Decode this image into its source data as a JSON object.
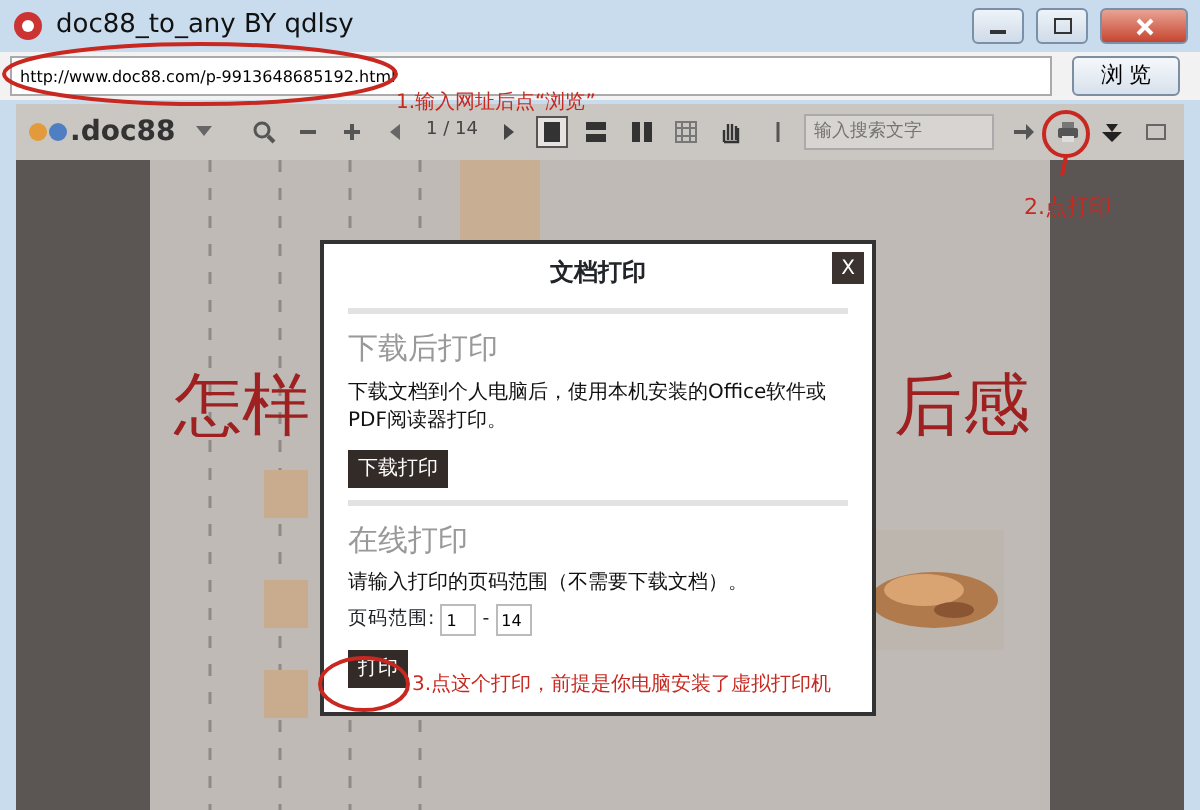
{
  "window": {
    "title": "doc88_to_any BY qdlsy"
  },
  "address_bar": {
    "value": "http://www.doc88.com/p-9913648685192.html",
    "button": "浏 览"
  },
  "toolbar": {
    "logo": ".doc88",
    "page": "1 / 14",
    "search": {
      "placeholder": "输入搜索文字"
    },
    "view_modes": [
      {
        "selected": true
      },
      {
        "selected": false
      },
      {
        "selected": false
      },
      {
        "selected": false
      }
    ]
  },
  "document": {
    "heading_parts": [
      "怎样",
      "后感"
    ]
  },
  "dialog": {
    "title": "文档打印",
    "close": "X",
    "download": {
      "heading": "下载后打印",
      "text": "下载文档到个人电脑后，使用本机安装的Office软件或PDF阅读器打印。",
      "button": "下载打印"
    },
    "online": {
      "heading": "在线打印",
      "text": "请输入打印的页码范围（不需要下载文档）。",
      "range_label": "页码范围:",
      "from": "1",
      "separator": "-",
      "to": "14",
      "button": "打印"
    }
  },
  "annotations": [
    {
      "text": "1.输入网址后点“浏览”"
    },
    {
      "text": "2.点打印"
    },
    {
      "text": "3.点这个打印，前提是你电脑安装了虚拟打印机"
    }
  ]
}
